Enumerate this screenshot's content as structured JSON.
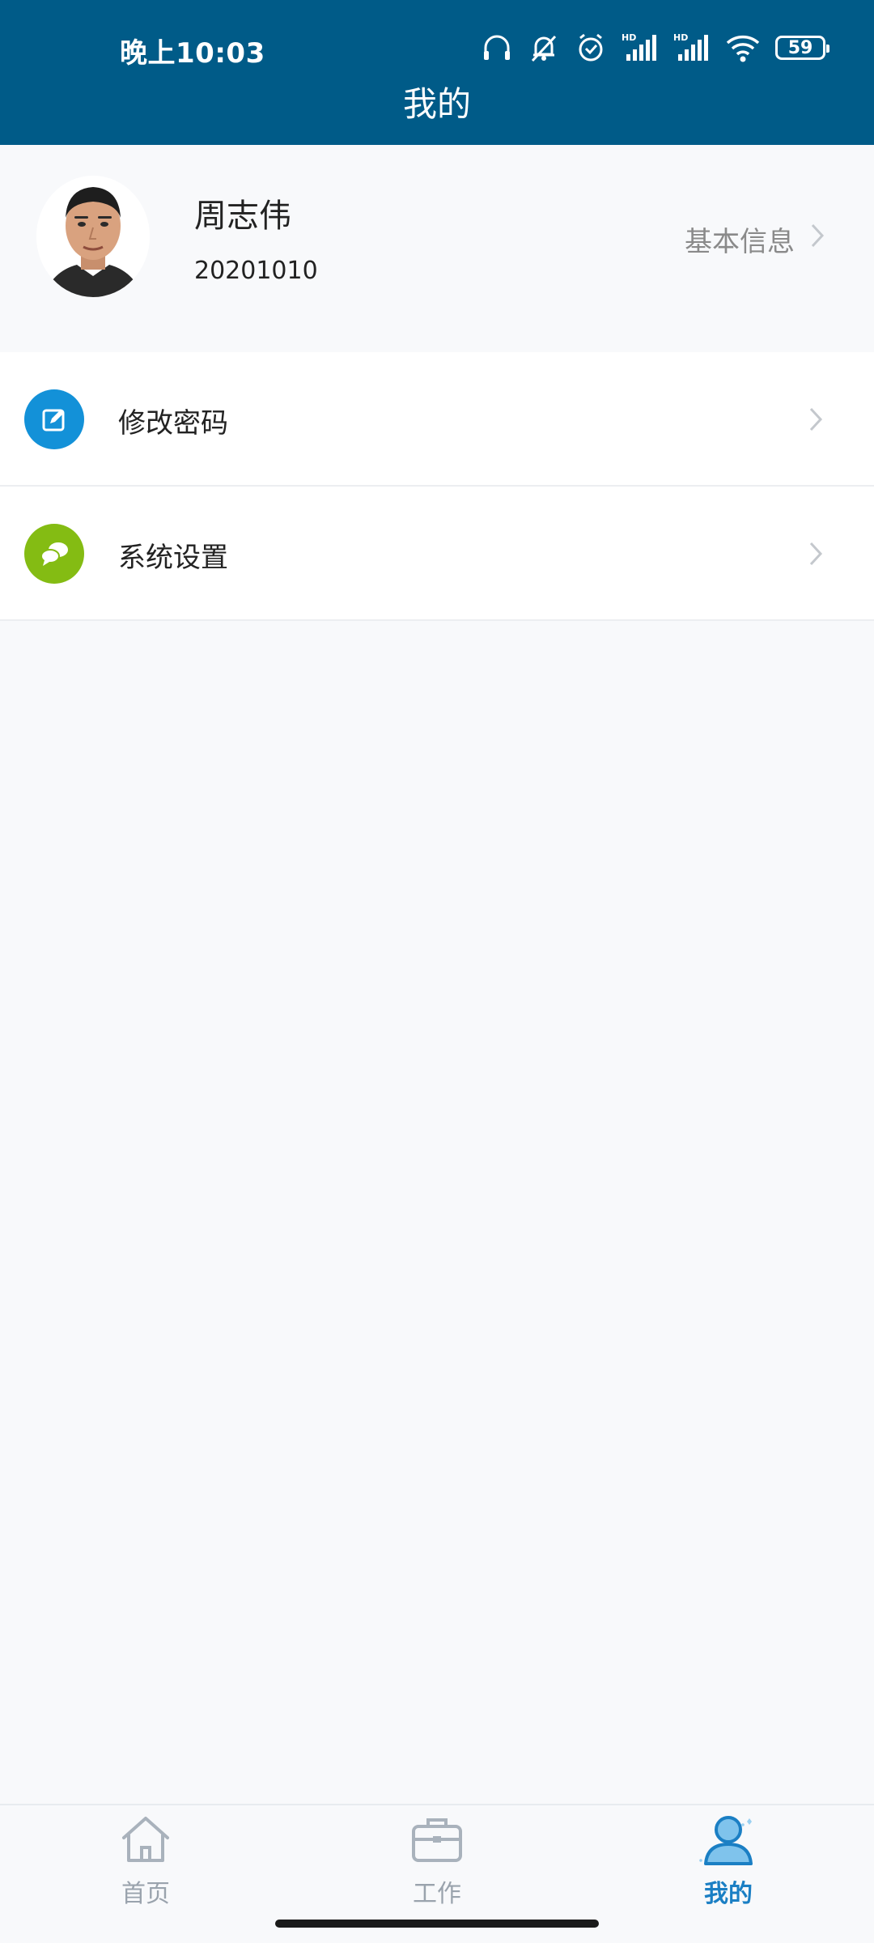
{
  "status_bar": {
    "time": "晚上10:03",
    "battery": "59",
    "icons": [
      "headphones-icon",
      "mute-icon",
      "alarm-icon",
      "hd-signal-icon",
      "hd-signal-icon",
      "wifi-icon",
      "battery-icon"
    ]
  },
  "header": {
    "title": "我的"
  },
  "profile": {
    "name": "周志伟",
    "id": "20201010",
    "link_label": "基本信息"
  },
  "menu": {
    "items": [
      {
        "label": "修改密码",
        "icon": "edit-icon",
        "color": "#1391d8"
      },
      {
        "label": "系统设置",
        "icon": "chat-bubbles-icon",
        "color": "#84bc13"
      }
    ]
  },
  "bottom_nav": {
    "items": [
      {
        "label": "首页",
        "icon": "home-icon",
        "active": false
      },
      {
        "label": "工作",
        "icon": "briefcase-icon",
        "active": false
      },
      {
        "label": "我的",
        "icon": "user-icon",
        "active": true
      }
    ]
  },
  "colors": {
    "header_bg": "#005b88",
    "active_tab": "#1b7fc4",
    "inactive_tab": "#9aa3ad",
    "page_bg": "#f8f9fb"
  }
}
